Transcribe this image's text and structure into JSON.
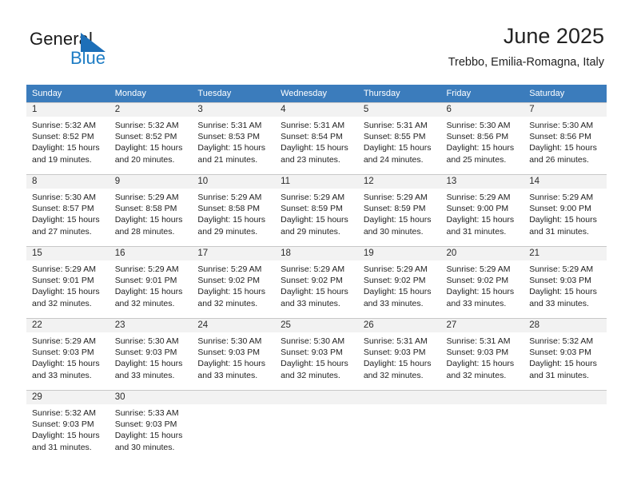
{
  "brand": {
    "name_part1": "General",
    "name_part2": "Blue",
    "triangle_color": "#1d6fb8",
    "blue_color": "#1d7cc4"
  },
  "header": {
    "title": "June 2025",
    "subtitle": "Trebbo, Emilia-Romagna, Italy"
  },
  "theme": {
    "header_row_bg": "#3b7cbc",
    "header_row_text": "#ffffff",
    "daynum_band_bg": "#f2f2f2",
    "grid_line": "#c8c8c8"
  },
  "weekdays": [
    "Sunday",
    "Monday",
    "Tuesday",
    "Wednesday",
    "Thursday",
    "Friday",
    "Saturday"
  ],
  "weeks": [
    [
      {
        "day": "1",
        "sunrise": "Sunrise: 5:32 AM",
        "sunset": "Sunset: 8:52 PM",
        "daylight1": "Daylight: 15 hours",
        "daylight2": "and 19 minutes."
      },
      {
        "day": "2",
        "sunrise": "Sunrise: 5:32 AM",
        "sunset": "Sunset: 8:52 PM",
        "daylight1": "Daylight: 15 hours",
        "daylight2": "and 20 minutes."
      },
      {
        "day": "3",
        "sunrise": "Sunrise: 5:31 AM",
        "sunset": "Sunset: 8:53 PM",
        "daylight1": "Daylight: 15 hours",
        "daylight2": "and 21 minutes."
      },
      {
        "day": "4",
        "sunrise": "Sunrise: 5:31 AM",
        "sunset": "Sunset: 8:54 PM",
        "daylight1": "Daylight: 15 hours",
        "daylight2": "and 23 minutes."
      },
      {
        "day": "5",
        "sunrise": "Sunrise: 5:31 AM",
        "sunset": "Sunset: 8:55 PM",
        "daylight1": "Daylight: 15 hours",
        "daylight2": "and 24 minutes."
      },
      {
        "day": "6",
        "sunrise": "Sunrise: 5:30 AM",
        "sunset": "Sunset: 8:56 PM",
        "daylight1": "Daylight: 15 hours",
        "daylight2": "and 25 minutes."
      },
      {
        "day": "7",
        "sunrise": "Sunrise: 5:30 AM",
        "sunset": "Sunset: 8:56 PM",
        "daylight1": "Daylight: 15 hours",
        "daylight2": "and 26 minutes."
      }
    ],
    [
      {
        "day": "8",
        "sunrise": "Sunrise: 5:30 AM",
        "sunset": "Sunset: 8:57 PM",
        "daylight1": "Daylight: 15 hours",
        "daylight2": "and 27 minutes."
      },
      {
        "day": "9",
        "sunrise": "Sunrise: 5:29 AM",
        "sunset": "Sunset: 8:58 PM",
        "daylight1": "Daylight: 15 hours",
        "daylight2": "and 28 minutes."
      },
      {
        "day": "10",
        "sunrise": "Sunrise: 5:29 AM",
        "sunset": "Sunset: 8:58 PM",
        "daylight1": "Daylight: 15 hours",
        "daylight2": "and 29 minutes."
      },
      {
        "day": "11",
        "sunrise": "Sunrise: 5:29 AM",
        "sunset": "Sunset: 8:59 PM",
        "daylight1": "Daylight: 15 hours",
        "daylight2": "and 29 minutes."
      },
      {
        "day": "12",
        "sunrise": "Sunrise: 5:29 AM",
        "sunset": "Sunset: 8:59 PM",
        "daylight1": "Daylight: 15 hours",
        "daylight2": "and 30 minutes."
      },
      {
        "day": "13",
        "sunrise": "Sunrise: 5:29 AM",
        "sunset": "Sunset: 9:00 PM",
        "daylight1": "Daylight: 15 hours",
        "daylight2": "and 31 minutes."
      },
      {
        "day": "14",
        "sunrise": "Sunrise: 5:29 AM",
        "sunset": "Sunset: 9:00 PM",
        "daylight1": "Daylight: 15 hours",
        "daylight2": "and 31 minutes."
      }
    ],
    [
      {
        "day": "15",
        "sunrise": "Sunrise: 5:29 AM",
        "sunset": "Sunset: 9:01 PM",
        "daylight1": "Daylight: 15 hours",
        "daylight2": "and 32 minutes."
      },
      {
        "day": "16",
        "sunrise": "Sunrise: 5:29 AM",
        "sunset": "Sunset: 9:01 PM",
        "daylight1": "Daylight: 15 hours",
        "daylight2": "and 32 minutes."
      },
      {
        "day": "17",
        "sunrise": "Sunrise: 5:29 AM",
        "sunset": "Sunset: 9:02 PM",
        "daylight1": "Daylight: 15 hours",
        "daylight2": "and 32 minutes."
      },
      {
        "day": "18",
        "sunrise": "Sunrise: 5:29 AM",
        "sunset": "Sunset: 9:02 PM",
        "daylight1": "Daylight: 15 hours",
        "daylight2": "and 33 minutes."
      },
      {
        "day": "19",
        "sunrise": "Sunrise: 5:29 AM",
        "sunset": "Sunset: 9:02 PM",
        "daylight1": "Daylight: 15 hours",
        "daylight2": "and 33 minutes."
      },
      {
        "day": "20",
        "sunrise": "Sunrise: 5:29 AM",
        "sunset": "Sunset: 9:02 PM",
        "daylight1": "Daylight: 15 hours",
        "daylight2": "and 33 minutes."
      },
      {
        "day": "21",
        "sunrise": "Sunrise: 5:29 AM",
        "sunset": "Sunset: 9:03 PM",
        "daylight1": "Daylight: 15 hours",
        "daylight2": "and 33 minutes."
      }
    ],
    [
      {
        "day": "22",
        "sunrise": "Sunrise: 5:29 AM",
        "sunset": "Sunset: 9:03 PM",
        "daylight1": "Daylight: 15 hours",
        "daylight2": "and 33 minutes."
      },
      {
        "day": "23",
        "sunrise": "Sunrise: 5:30 AM",
        "sunset": "Sunset: 9:03 PM",
        "daylight1": "Daylight: 15 hours",
        "daylight2": "and 33 minutes."
      },
      {
        "day": "24",
        "sunrise": "Sunrise: 5:30 AM",
        "sunset": "Sunset: 9:03 PM",
        "daylight1": "Daylight: 15 hours",
        "daylight2": "and 33 minutes."
      },
      {
        "day": "25",
        "sunrise": "Sunrise: 5:30 AM",
        "sunset": "Sunset: 9:03 PM",
        "daylight1": "Daylight: 15 hours",
        "daylight2": "and 32 minutes."
      },
      {
        "day": "26",
        "sunrise": "Sunrise: 5:31 AM",
        "sunset": "Sunset: 9:03 PM",
        "daylight1": "Daylight: 15 hours",
        "daylight2": "and 32 minutes."
      },
      {
        "day": "27",
        "sunrise": "Sunrise: 5:31 AM",
        "sunset": "Sunset: 9:03 PM",
        "daylight1": "Daylight: 15 hours",
        "daylight2": "and 32 minutes."
      },
      {
        "day": "28",
        "sunrise": "Sunrise: 5:32 AM",
        "sunset": "Sunset: 9:03 PM",
        "daylight1": "Daylight: 15 hours",
        "daylight2": "and 31 minutes."
      }
    ],
    [
      {
        "day": "29",
        "sunrise": "Sunrise: 5:32 AM",
        "sunset": "Sunset: 9:03 PM",
        "daylight1": "Daylight: 15 hours",
        "daylight2": "and 31 minutes."
      },
      {
        "day": "30",
        "sunrise": "Sunrise: 5:33 AM",
        "sunset": "Sunset: 9:03 PM",
        "daylight1": "Daylight: 15 hours",
        "daylight2": "and 30 minutes."
      },
      {
        "day": "",
        "sunrise": "",
        "sunset": "",
        "daylight1": "",
        "daylight2": ""
      },
      {
        "day": "",
        "sunrise": "",
        "sunset": "",
        "daylight1": "",
        "daylight2": ""
      },
      {
        "day": "",
        "sunrise": "",
        "sunset": "",
        "daylight1": "",
        "daylight2": ""
      },
      {
        "day": "",
        "sunrise": "",
        "sunset": "",
        "daylight1": "",
        "daylight2": ""
      },
      {
        "day": "",
        "sunrise": "",
        "sunset": "",
        "daylight1": "",
        "daylight2": ""
      }
    ]
  ]
}
